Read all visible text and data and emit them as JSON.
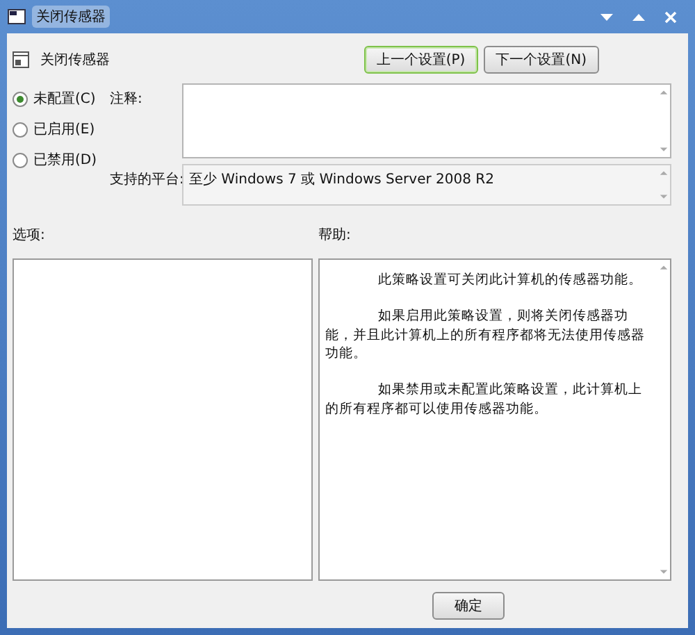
{
  "window": {
    "title": "关闭传感器"
  },
  "header": {
    "title": "关闭传感器"
  },
  "nav_buttons": [
    {
      "label": "上一个设置(P)",
      "focused": true
    },
    {
      "label": "下一个设置(N)",
      "focused": false
    }
  ],
  "radios": [
    {
      "label": "未配置(C)",
      "selected": true
    },
    {
      "label": "已启用(E)",
      "selected": false
    },
    {
      "label": "已禁用(D)",
      "selected": false
    }
  ],
  "comment": {
    "label": "注释:"
  },
  "platform": {
    "label": "支持的平台:",
    "value": "至少 Windows 7 或 Windows Server 2008 R2"
  },
  "options": {
    "label": "选项:"
  },
  "help": {
    "label": "帮助:",
    "paragraphs": [
      "此策略设置可关闭此计算机的传感器功能。",
      "如果启用此策略设置，则将关闭传感器功能，并且此计算机上的所有程序都将无法使用传感器功能。",
      "如果禁用或未配置此策略设置，此计算机上的所有程序都可以使用传感器功能。"
    ]
  },
  "footer_buttons": [
    "确定"
  ]
}
